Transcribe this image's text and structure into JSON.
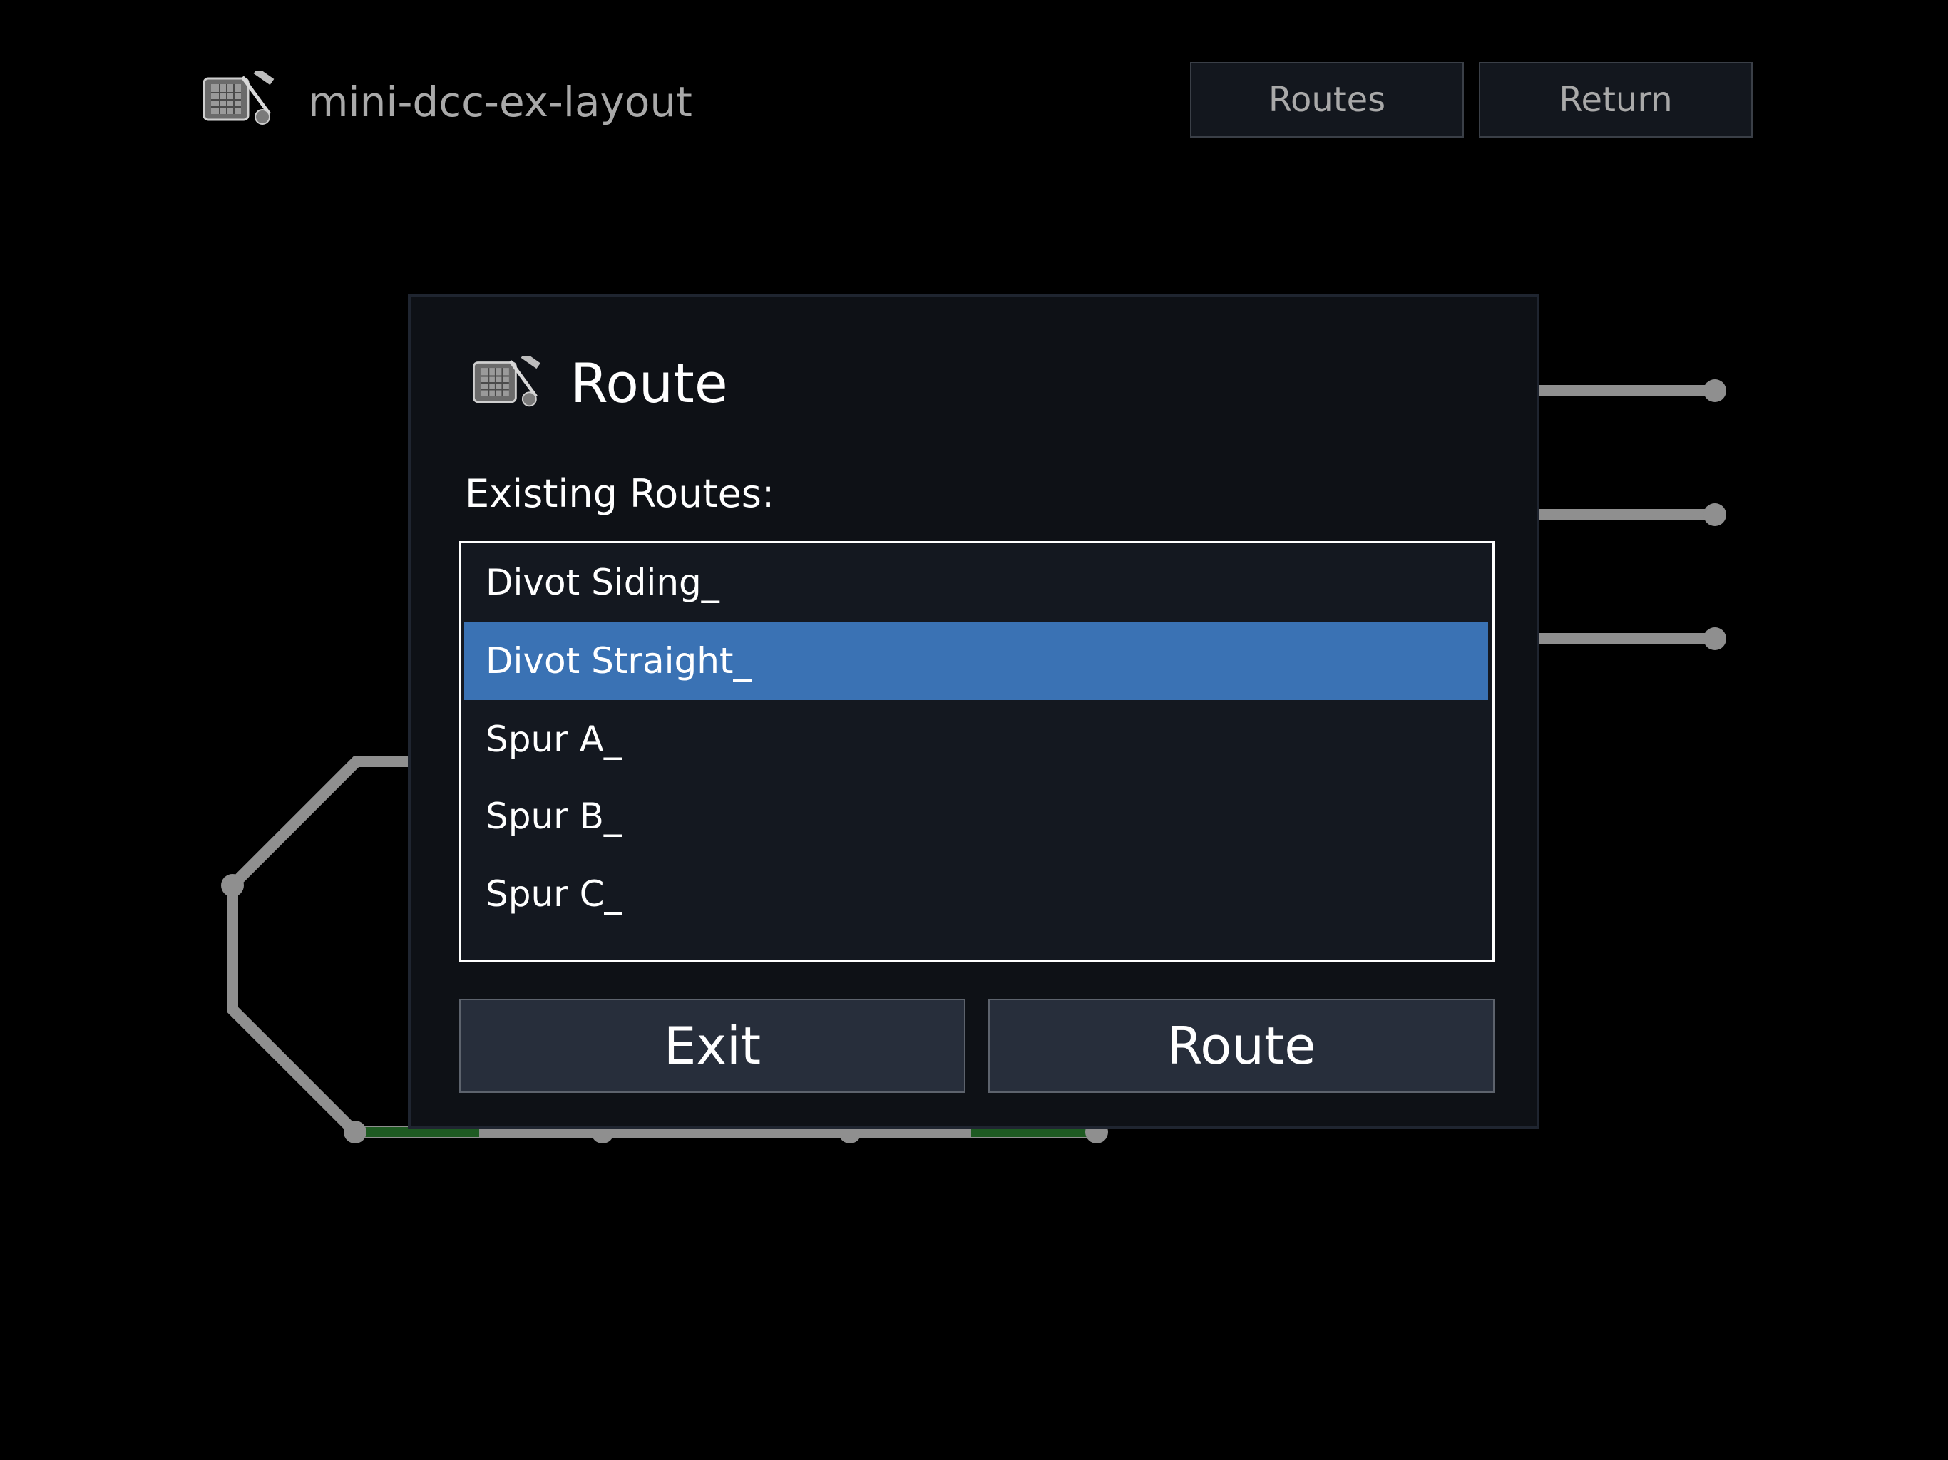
{
  "header": {
    "title": "mini-dcc-ex-layout",
    "routes_label": "Routes",
    "return_label": "Return"
  },
  "dialog": {
    "title": "Route",
    "list_label": "Existing Routes:",
    "routes": [
      {
        "label": "Divot Siding_",
        "selected": false
      },
      {
        "label": "Divot Straight_",
        "selected": true
      },
      {
        "label": "Spur A_",
        "selected": false
      },
      {
        "label": "Spur B_",
        "selected": false
      },
      {
        "label": "Spur C_",
        "selected": false
      }
    ],
    "exit_label": "Exit",
    "route_label": "Route"
  },
  "colors": {
    "background": "#000000",
    "track": "#8f8f8f",
    "track_active": "#1e5a22",
    "dialog_bg": "#0e1116",
    "selection": "#3a72b4",
    "button_bg": "#272e3b"
  }
}
